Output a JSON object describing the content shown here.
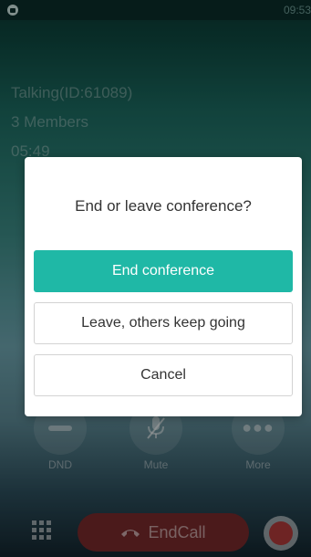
{
  "status_bar": {
    "time": "09:53",
    "notification_icon": "app-notification-icon"
  },
  "call": {
    "title": "Talking(ID:61089)",
    "members": "3 Members",
    "duration": "05:49"
  },
  "actions": [
    {
      "label": "DND",
      "icon": "dnd-icon"
    },
    {
      "label": "Mute",
      "icon": "mute-icon"
    },
    {
      "label": "More",
      "icon": "more-icon"
    }
  ],
  "bottom": {
    "keypad_icon": "keypad-icon",
    "endcall_label": "EndCall",
    "endcall_icon": "phone-hangup-icon",
    "record_icon": "record-icon"
  },
  "dialog": {
    "title": "End or leave conference?",
    "end_label": "End conference",
    "leave_label": "Leave, others keep going",
    "cancel_label": "Cancel"
  },
  "colors": {
    "accent": "#1fb8a6",
    "endcall": "#7a2a2c",
    "record": "#b23a3a"
  }
}
